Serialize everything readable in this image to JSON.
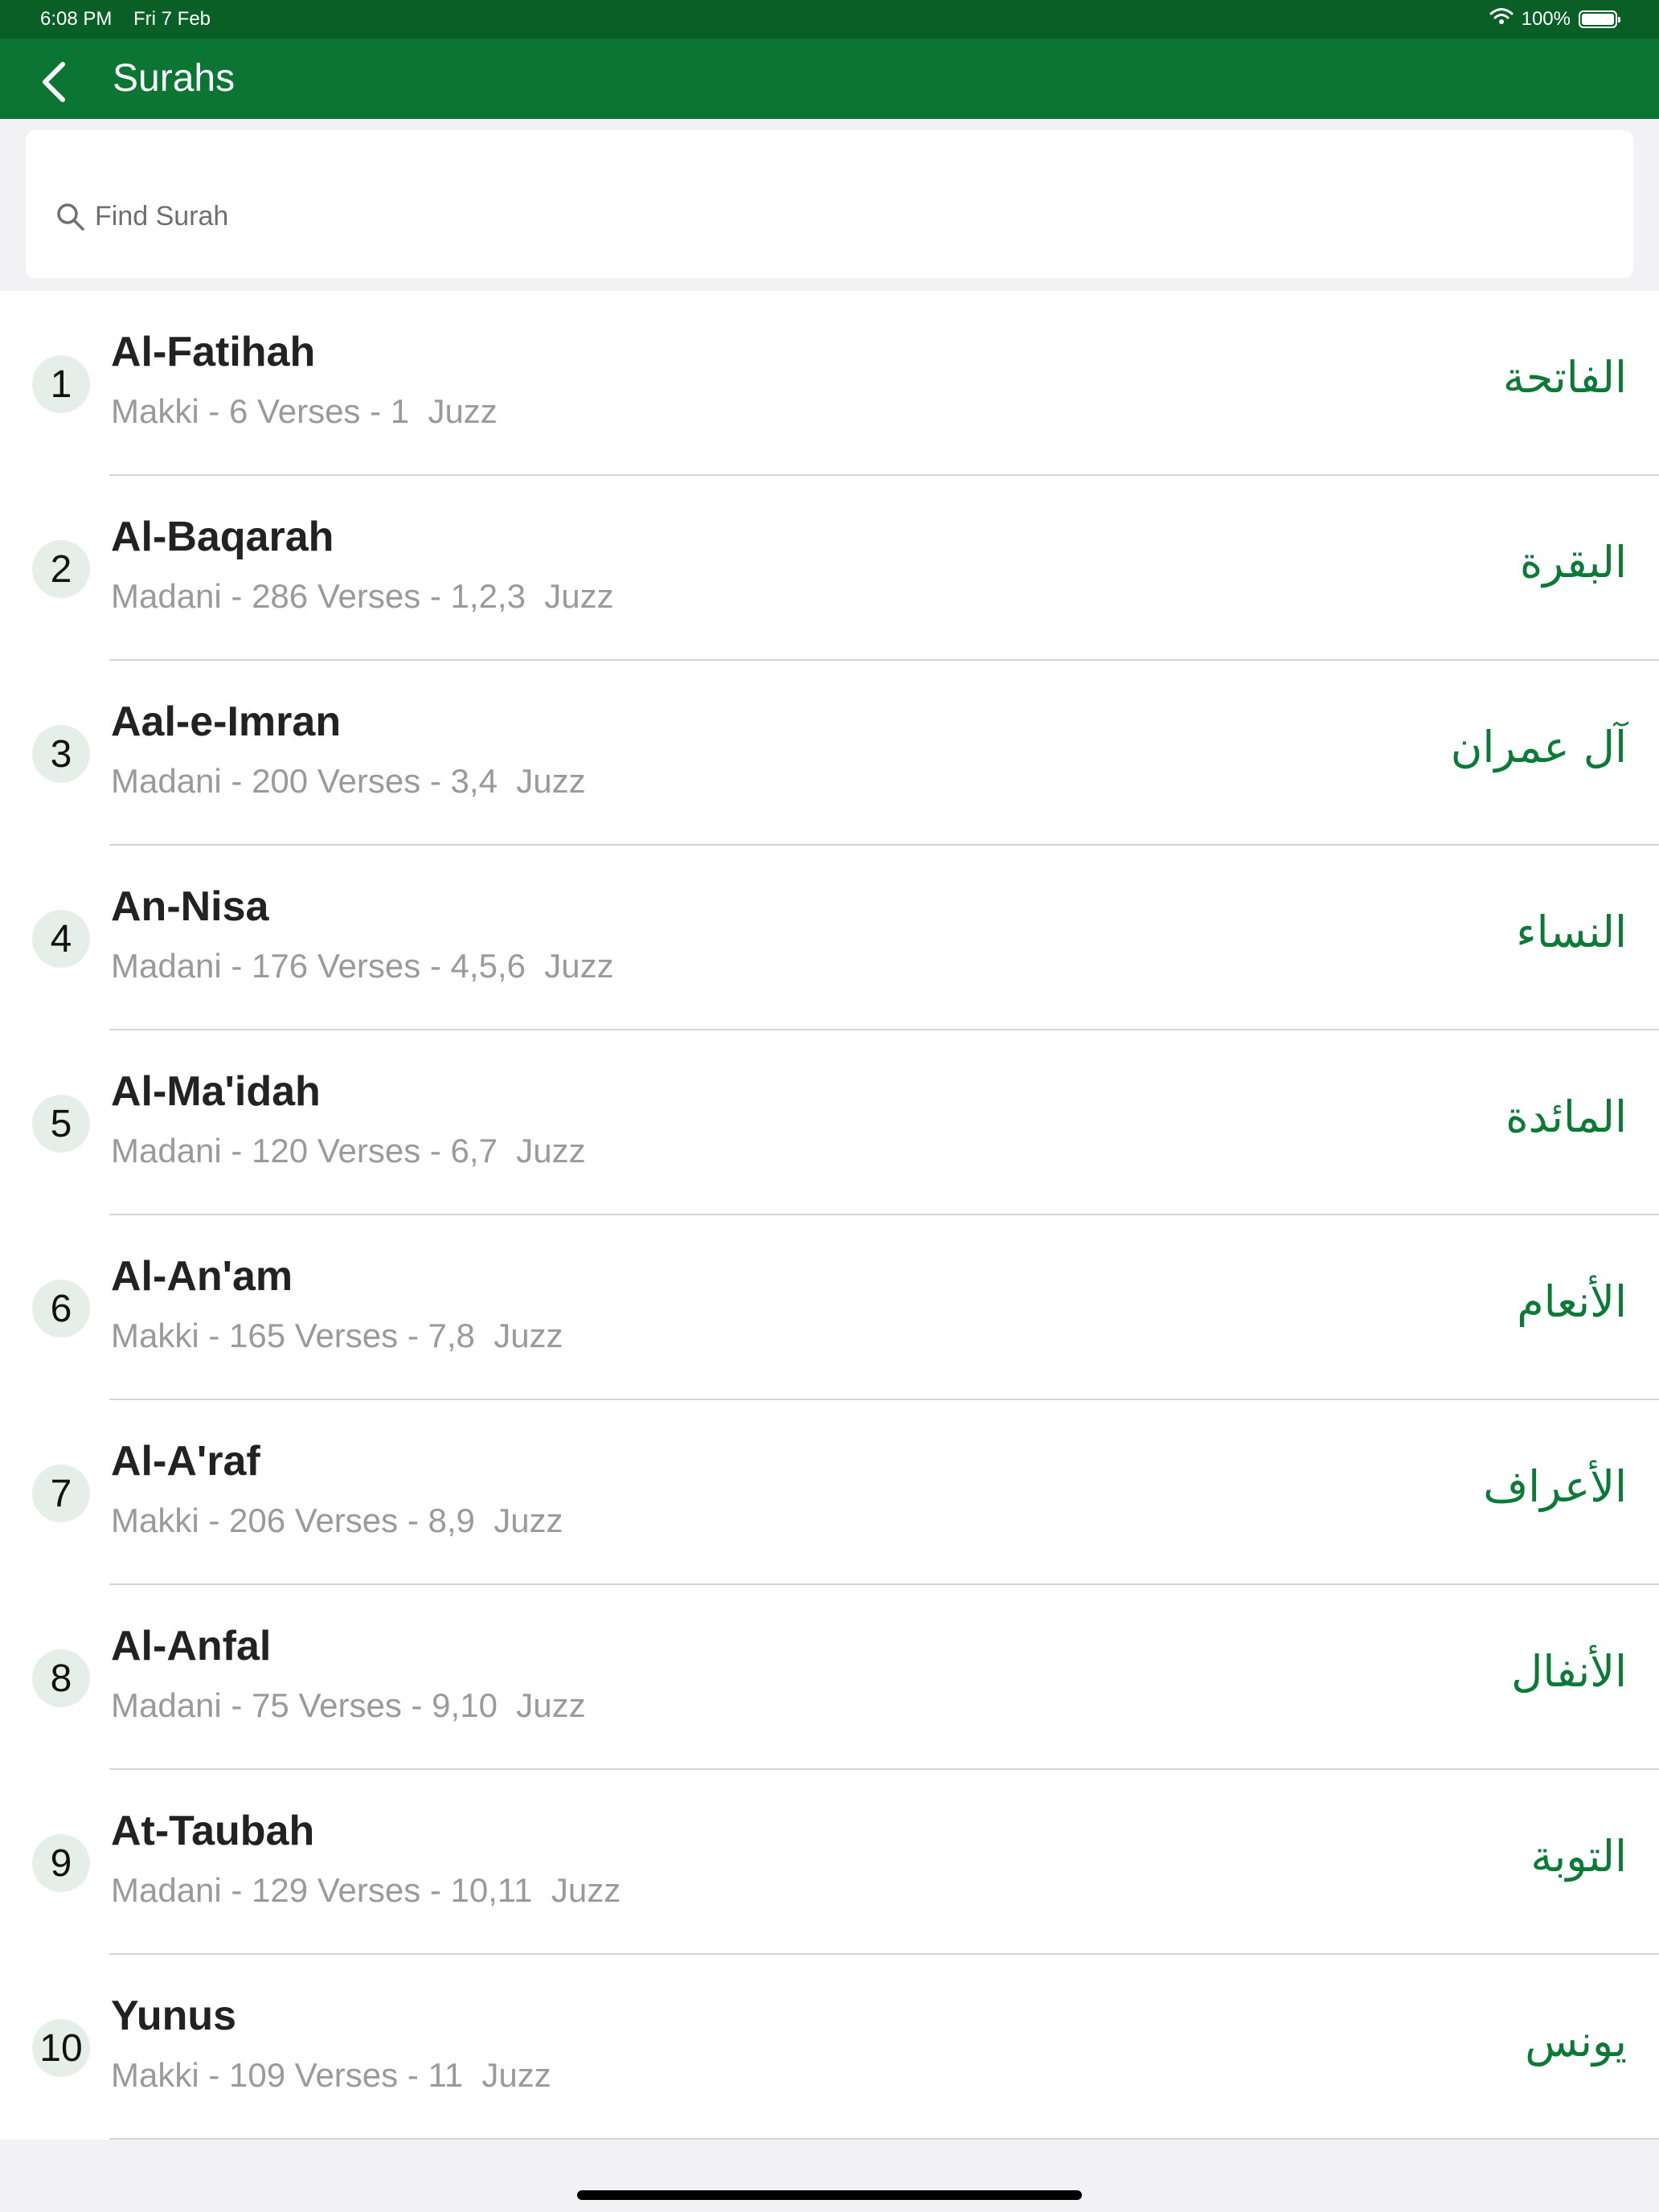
{
  "status_bar": {
    "time": "6:08 PM",
    "date": "Fri 7 Feb",
    "battery": "100%",
    "icons": [
      "wifi-icon",
      "battery-icon"
    ]
  },
  "nav": {
    "title": "Surahs",
    "back_icon": "chevron-left-icon"
  },
  "search": {
    "placeholder": "Find Surah",
    "value": "",
    "icon": "search-icon"
  },
  "surahs": [
    {
      "number": "1",
      "name": "Al-Fatihah",
      "details": "Makki - 6 Verses - 1  Juzz",
      "arabic": "الفاتحة"
    },
    {
      "number": "2",
      "name": "Al-Baqarah",
      "details": "Madani - 286 Verses - 1,2,3  Juzz",
      "arabic": "البقرة"
    },
    {
      "number": "3",
      "name": "Aal-e-Imran",
      "details": "Madani - 200 Verses - 3,4  Juzz",
      "arabic": "آل عمران"
    },
    {
      "number": "4",
      "name": "An-Nisa",
      "details": "Madani - 176 Verses - 4,5,6  Juzz",
      "arabic": "النساء"
    },
    {
      "number": "5",
      "name": "Al-Ma'idah",
      "details": "Madani - 120 Verses - 6,7  Juzz",
      "arabic": "المائدة"
    },
    {
      "number": "6",
      "name": "Al-An'am",
      "details": "Makki - 165 Verses - 7,8  Juzz",
      "arabic": "الأنعام"
    },
    {
      "number": "7",
      "name": "Al-A'raf",
      "details": "Makki - 206 Verses - 8,9  Juzz",
      "arabic": "الأعراف"
    },
    {
      "number": "8",
      "name": "Al-Anfal",
      "details": "Madani - 75 Verses - 9,10  Juzz",
      "arabic": "الأنفال"
    },
    {
      "number": "9",
      "name": "At-Taubah",
      "details": "Madani - 129 Verses - 10,11  Juzz",
      "arabic": "التوبة"
    },
    {
      "number": "10",
      "name": "Yunus",
      "details": "Makki - 109 Verses - 11  Juzz",
      "arabic": "يونس"
    }
  ],
  "colors": {
    "status_bar_bg": "#0a5f27",
    "nav_bg": "#0b7534",
    "arabic_text": "#0b7a36",
    "badge_bg": "#e6eeea"
  }
}
